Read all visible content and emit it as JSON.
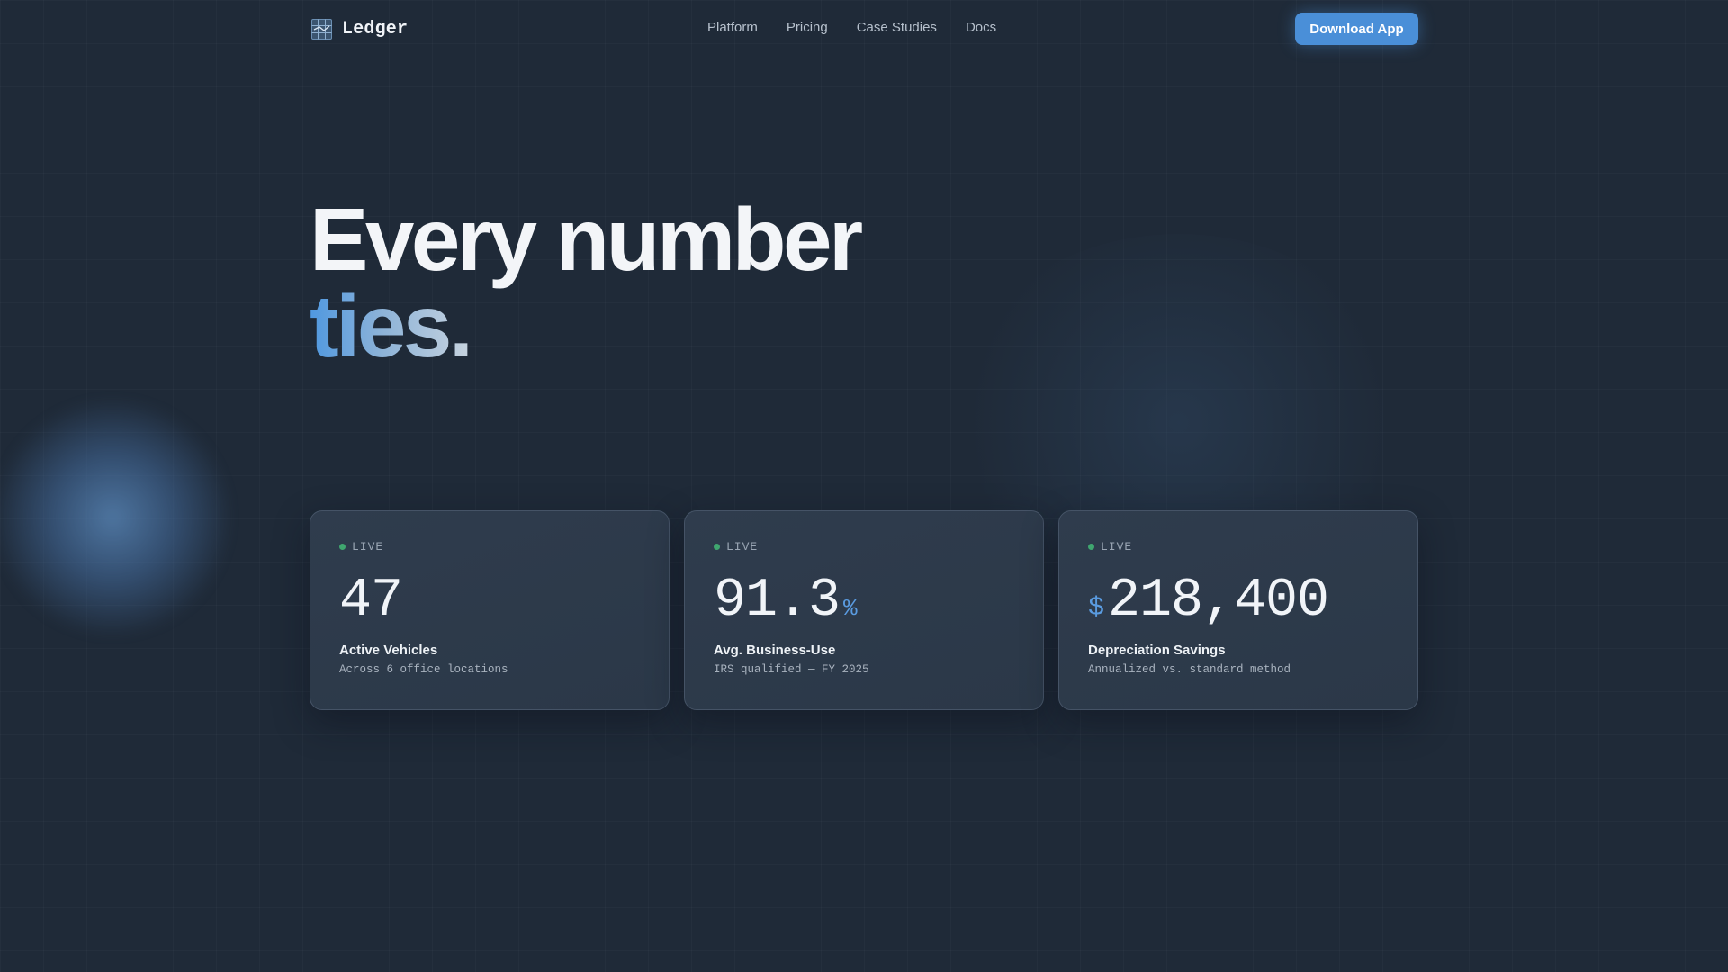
{
  "brand": {
    "name": "Ledger",
    "icon": "ledger-grid-icon"
  },
  "nav": {
    "links": [
      "Platform",
      "Pricing",
      "Case Studies",
      "Docs"
    ],
    "cta_label": "Download App"
  },
  "hero": {
    "line1": "Every number",
    "line2": "ties."
  },
  "cards": [
    {
      "status": "LIVE",
      "prefix": "",
      "value": "47",
      "suffix": "",
      "title": "Active Vehicles",
      "subtitle": "Across 6 office locations"
    },
    {
      "status": "LIVE",
      "prefix": "",
      "value": "91.3",
      "suffix": "%",
      "title": "Avg. Business-Use",
      "subtitle": "IRS qualified — FY 2025"
    },
    {
      "status": "LIVE",
      "prefix": "$",
      "value": "218,400",
      "suffix": "",
      "title": "Depreciation Savings",
      "subtitle": "Annualized vs. standard method"
    }
  ],
  "colors": {
    "background": "#1f2a38",
    "accent": "#4a8fd8",
    "live": "#3fa66f"
  }
}
